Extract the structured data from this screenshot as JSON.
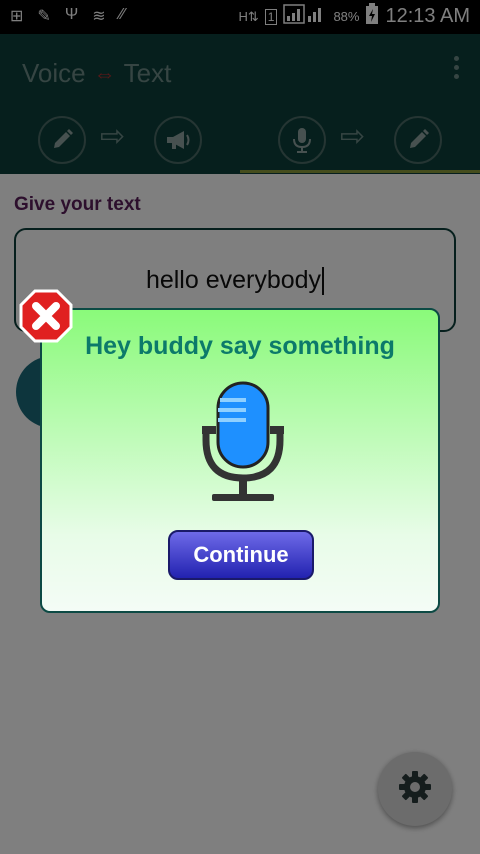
{
  "status_bar": {
    "battery": "88%",
    "sim": "1",
    "time": "12:13 AM"
  },
  "app_bar": {
    "title_left": "Voice",
    "title_arrow": "⇔",
    "title_right": "Text"
  },
  "content": {
    "label": "Give your text",
    "input_value": "hello everybody"
  },
  "dialog": {
    "title": "Hey buddy say something",
    "continue_label": "Continue"
  },
  "colors": {
    "appbar": "#0c3f3a",
    "dialog_top": "#8afa7a",
    "button": "#2222b0",
    "label": "#5a1e5a"
  }
}
